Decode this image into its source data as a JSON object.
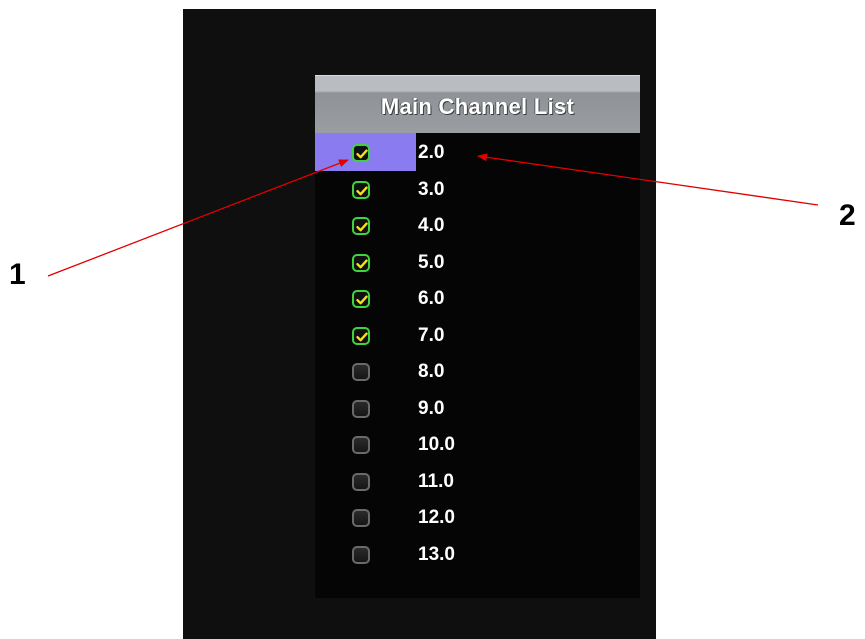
{
  "panel": {
    "title": "Main Channel List"
  },
  "channels": [
    {
      "number": "2.0",
      "checked": true,
      "highlighted": true
    },
    {
      "number": "3.0",
      "checked": true,
      "highlighted": false
    },
    {
      "number": "4.0",
      "checked": true,
      "highlighted": false
    },
    {
      "number": "5.0",
      "checked": true,
      "highlighted": false
    },
    {
      "number": "6.0",
      "checked": true,
      "highlighted": false
    },
    {
      "number": "7.0",
      "checked": true,
      "highlighted": false
    },
    {
      "number": "8.0",
      "checked": false,
      "highlighted": false
    },
    {
      "number": "9.0",
      "checked": false,
      "highlighted": false
    },
    {
      "number": "10.0",
      "checked": false,
      "highlighted": false
    },
    {
      "number": "11.0",
      "checked": false,
      "highlighted": false
    },
    {
      "number": "12.0",
      "checked": false,
      "highlighted": false
    },
    {
      "number": "13.0",
      "checked": false,
      "highlighted": false
    }
  ],
  "callouts": {
    "label_1": "1",
    "label_2": "2"
  },
  "colors": {
    "highlight": "#8a7cf0",
    "checkbox_on_border": "#3ed43e",
    "checkmark": "#f2e21a",
    "checkbox_off_border": "#6a6a6a",
    "callout_line": "#e00000",
    "background": "#0f0f0f"
  },
  "icons": {
    "checked": "checkbox-checked-icon",
    "unchecked": "checkbox-unchecked-icon"
  }
}
